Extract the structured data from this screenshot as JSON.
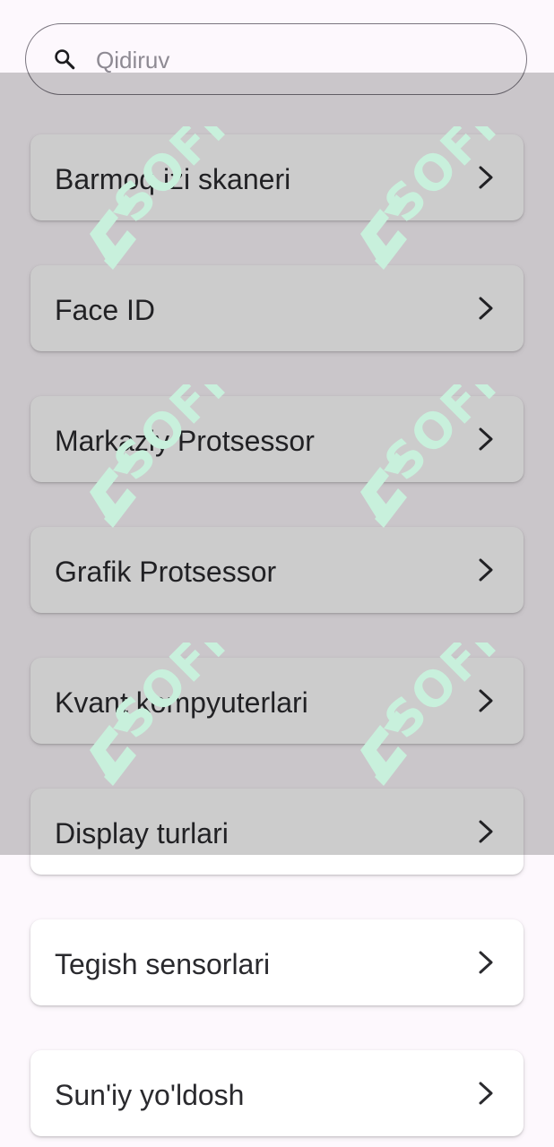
{
  "search": {
    "placeholder": "Qidiruv",
    "icon": "search-icon",
    "value": ""
  },
  "items": [
    {
      "label": "Barmoq izi skaneri",
      "icon": "chevron-right-icon"
    },
    {
      "label": "Face ID",
      "icon": "chevron-right-icon"
    },
    {
      "label": "Markaziy Protsessor",
      "icon": "chevron-right-icon"
    },
    {
      "label": "Grafik Protsessor",
      "icon": "chevron-right-icon"
    },
    {
      "label": "Kvant kompyuterlari",
      "icon": "chevron-right-icon"
    },
    {
      "label": "Display turlari",
      "icon": "chevron-right-icon"
    },
    {
      "label": "Tegish sensorlari",
      "icon": "chevron-right-icon"
    },
    {
      "label": "Sun'iy yo'ldosh",
      "icon": "chevron-right-icon"
    }
  ],
  "watermark": {
    "text": "SOFF",
    "color": "#C8F0DC"
  },
  "colors": {
    "background": "#FDF8FD",
    "card": "#FFFFFF",
    "text": "#2A2A2E",
    "outline": "#7A757F",
    "placeholder": "#8E8A93"
  }
}
